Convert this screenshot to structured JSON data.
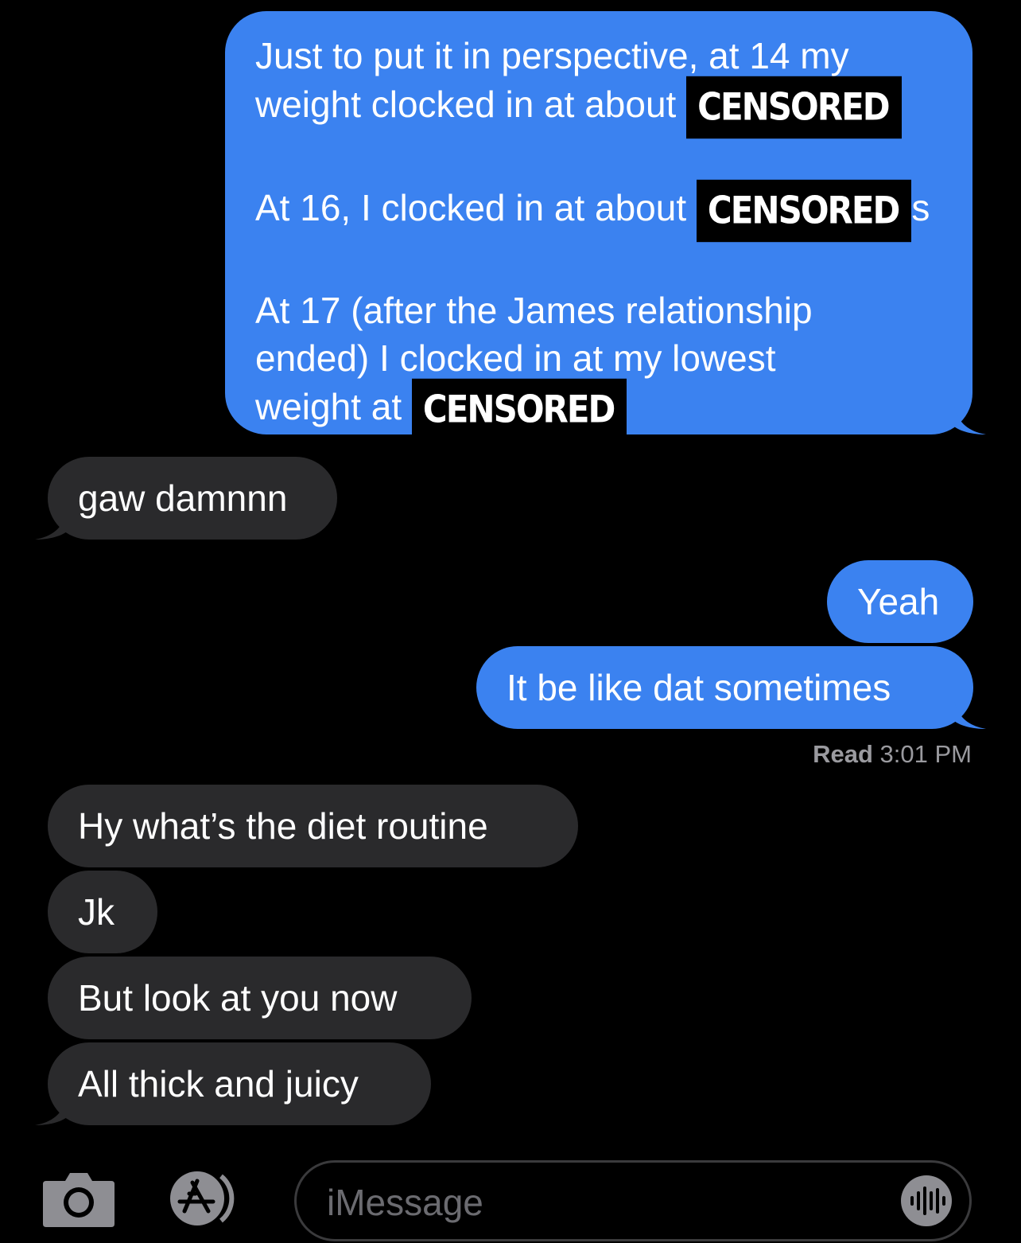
{
  "messages": [
    {
      "side": "sent",
      "lines": [
        {
          "text": "Just to put it in perspective, at 14 my"
        },
        {
          "text": "weight clocked in at about",
          "censor": "CENSORED"
        },
        {
          "text": "At 16, I clocked in at about",
          "censor": "CENSORED",
          "suffix": "s"
        },
        {
          "text": "At 17 (after the James relationship"
        },
        {
          "text": "ended) I clocked in at my lowest"
        },
        {
          "text": "weight at",
          "censor": "CENSORED"
        }
      ]
    },
    {
      "side": "received",
      "text": "gaw damnnn"
    },
    {
      "side": "sent",
      "text": "Yeah"
    },
    {
      "side": "sent",
      "text": "It be like dat sometimes"
    },
    {
      "side": "received",
      "text": "Hy what’s the diet routine"
    },
    {
      "side": "received",
      "text": "Jk"
    },
    {
      "side": "received",
      "text": "But look at you now"
    },
    {
      "side": "received",
      "text": "All thick and juicy"
    }
  ],
  "read_receipt": {
    "label": "Read",
    "time": "3:01 PM"
  },
  "input_bar": {
    "placeholder": "iMessage",
    "icons": [
      "camera-icon",
      "app-store-icon",
      "audio-waveform-icon"
    ]
  },
  "colors": {
    "background": "#000000",
    "sent_bubble": "#3b82f0",
    "received_bubble": "#2a2a2c",
    "secondary_text": "#9a9a9f"
  }
}
